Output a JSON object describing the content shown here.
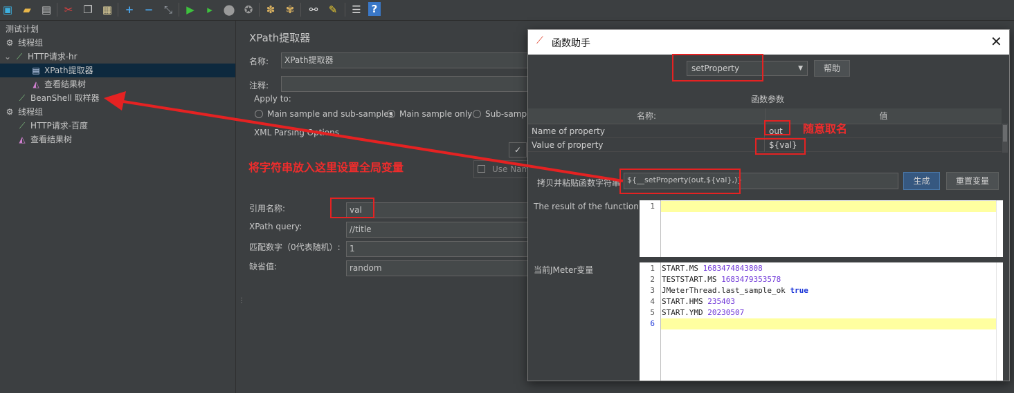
{
  "toolbar": {
    "icons": [
      "new-icon",
      "open-icon",
      "save-icon",
      "cut-icon",
      "copy-icon",
      "paste-icon",
      "expand-icon",
      "collapse-icon",
      "toggle-icon",
      "start-icon",
      "start-no-pauses-icon",
      "stop-icon",
      "shutdown-icon",
      "clear-icon",
      "clear-all-icon",
      "search-icon",
      "reset-search-icon",
      "function-helper-icon",
      "help-icon"
    ]
  },
  "tree": {
    "items": [
      {
        "label": "测试计划",
        "icon": "test-plan-icon"
      },
      {
        "label": "线程组",
        "icon": "gear-icon"
      },
      {
        "label": "HTTP请求-hr",
        "icon": "pipette-icon",
        "expander": "⌄"
      },
      {
        "label": "XPath提取器",
        "icon": "document-icon"
      },
      {
        "label": "查看结果树",
        "icon": "chart-icon"
      },
      {
        "label": "BeanShell 取样器",
        "icon": "pipette-icon"
      },
      {
        "label": "线程组",
        "icon": "gear-icon"
      },
      {
        "label": "HTTP请求-百度",
        "icon": "pipette-icon"
      },
      {
        "label": "查看结果树",
        "icon": "chart-icon"
      }
    ]
  },
  "extractor": {
    "title": "XPath提取器",
    "name_label": "名称:",
    "name_value": "XPath提取器",
    "comment_label": "注释:",
    "apply_to_label": "Apply to:",
    "apply_options": [
      "Main sample and sub-samples",
      "Main sample only",
      "Sub-sampl"
    ],
    "xml_options_label": "XML Parsing Options",
    "use_namespaces": "Use Nam",
    "ref_name_label": "引用名称:",
    "ref_name_value": "val",
    "xpath_label": "XPath query:",
    "xpath_value": "//title",
    "match_label": "匹配数字（0代表随机）:",
    "match_value": "1",
    "default_label": "缺省值:",
    "default_value": "random"
  },
  "annotations": {
    "arrow_text": "将字符串放入这里设置全局变量",
    "random_name": "随意取名"
  },
  "dialog": {
    "title": "函数助手",
    "function_select": "setProperty",
    "help_button": "帮助",
    "params_title": "函数参数",
    "col_name": "名称:",
    "col_value": "值",
    "rows": [
      {
        "name": "Name of property",
        "value": "out"
      },
      {
        "name": "Value of property",
        "value": "${val}"
      }
    ],
    "copy_label": "拷贝并粘贴函数字符串",
    "function_string": "${__setProperty(out,${val},)}",
    "generate_button": "生成",
    "reset_button": "重置变量",
    "result_label": "The result of the function is",
    "result_lines": [
      "1"
    ],
    "vars_label": "当前JMeter变量",
    "vars": [
      {
        "ln": "1",
        "key": "START.MS",
        "val": "1683474843808",
        "kw": false
      },
      {
        "ln": "2",
        "key": "TESTSTART.MS",
        "val": "1683479353578",
        "kw": false
      },
      {
        "ln": "3",
        "key": "JMeterThread.last_sample_ok",
        "val": "true",
        "kw": true
      },
      {
        "ln": "4",
        "key": "START.HMS",
        "val": "235403",
        "kw": false
      },
      {
        "ln": "5",
        "key": "START.YMD",
        "val": "20230507",
        "kw": false
      },
      {
        "ln": "6",
        "key": "",
        "val": "",
        "kw": false
      }
    ]
  },
  "colors": {
    "accent_red": "#e52222",
    "highlight_yellow": "#ffffa0",
    "selection": "#0d293e"
  }
}
